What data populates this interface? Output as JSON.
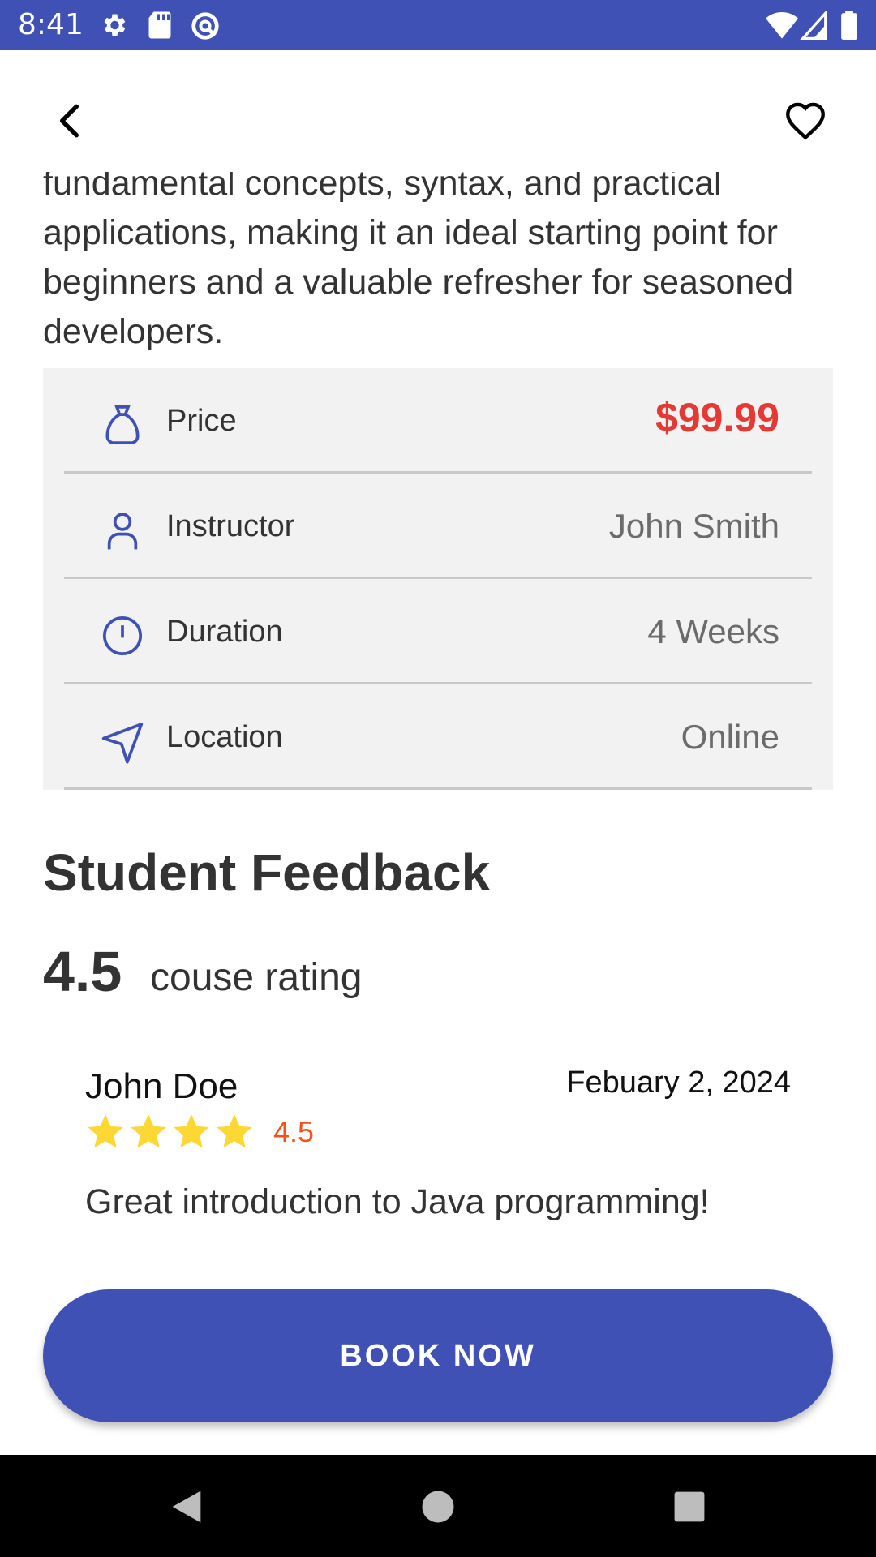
{
  "status_bar": {
    "time": "8:41",
    "icons": [
      "gear-icon",
      "sd-card-icon",
      "data-saver-icon",
      "wifi-icon",
      "signal-icon",
      "battery-icon"
    ]
  },
  "app_bar": {
    "back_icon": "chevron-left-icon",
    "favorite_icon": "heart-outline-icon"
  },
  "course": {
    "description_partial_top": "fundamental concepts, syntax, and practical",
    "description": "applications, making it an ideal starting point for beginners and a valuable refresher for seasoned developers."
  },
  "info": {
    "rows": [
      {
        "icon": "money-bag-icon",
        "label": "Price",
        "value": "$99.99"
      },
      {
        "icon": "person-icon",
        "label": "Instructor",
        "value": "John Smith"
      },
      {
        "icon": "clock-icon",
        "label": "Duration",
        "value": "4 Weeks"
      },
      {
        "icon": "navigation-arrow-icon",
        "label": "Location",
        "value": "Online"
      }
    ]
  },
  "feedback": {
    "title": "Student Feedback",
    "rating": "4.5",
    "rating_caption": "couse rating",
    "reviews": [
      {
        "name": "John Doe",
        "date": "Febuary 2, 2024",
        "stars": 4.5,
        "score": "4.5",
        "text": "Great introduction to Java programming!"
      }
    ]
  },
  "cta": {
    "label": "BOOK NOW"
  },
  "colors": {
    "primary": "#3f51b5",
    "price": "#e53935",
    "star": "#fdd835",
    "score": "#f4511e"
  },
  "nav_bar": {
    "buttons": [
      "back-triangle-icon",
      "home-circle-icon",
      "recents-square-icon"
    ]
  }
}
